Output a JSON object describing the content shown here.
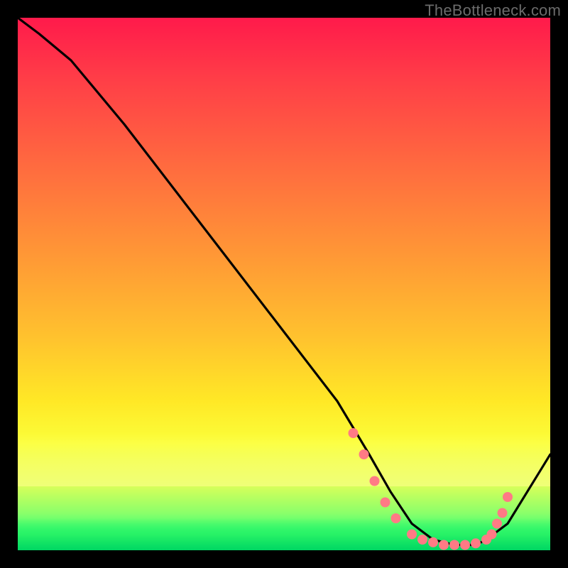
{
  "watermark": "TheBottleneck.com",
  "chart_data": {
    "type": "line",
    "title": "",
    "xlabel": "",
    "ylabel": "",
    "xlim": [
      0,
      100
    ],
    "ylim": [
      0,
      100
    ],
    "grid": false,
    "legend": false,
    "background": "vertical-gradient red→yellow→green (high value = red top, low value = green bottom)",
    "series": [
      {
        "name": "bottleneck-curve",
        "color": "#000000",
        "x": [
          0,
          4,
          10,
          20,
          30,
          40,
          50,
          60,
          66,
          70,
          74,
          78,
          82,
          86,
          88,
          92,
          100
        ],
        "y": [
          100,
          97,
          92,
          80,
          67,
          54,
          41,
          28,
          18,
          11,
          5,
          2,
          1,
          1,
          2,
          5,
          18
        ]
      }
    ],
    "markers": {
      "name": "highlight-points",
      "color": "#ff7a85",
      "radius": 7,
      "points_xy": [
        [
          63,
          22
        ],
        [
          65,
          18
        ],
        [
          67,
          13
        ],
        [
          69,
          9
        ],
        [
          71,
          6
        ],
        [
          74,
          3
        ],
        [
          76,
          2
        ],
        [
          78,
          1.5
        ],
        [
          80,
          1
        ],
        [
          82,
          1
        ],
        [
          84,
          1
        ],
        [
          86,
          1.3
        ],
        [
          88,
          2
        ],
        [
          89,
          3
        ],
        [
          90,
          5
        ],
        [
          91,
          7
        ],
        [
          92,
          10
        ]
      ]
    }
  }
}
